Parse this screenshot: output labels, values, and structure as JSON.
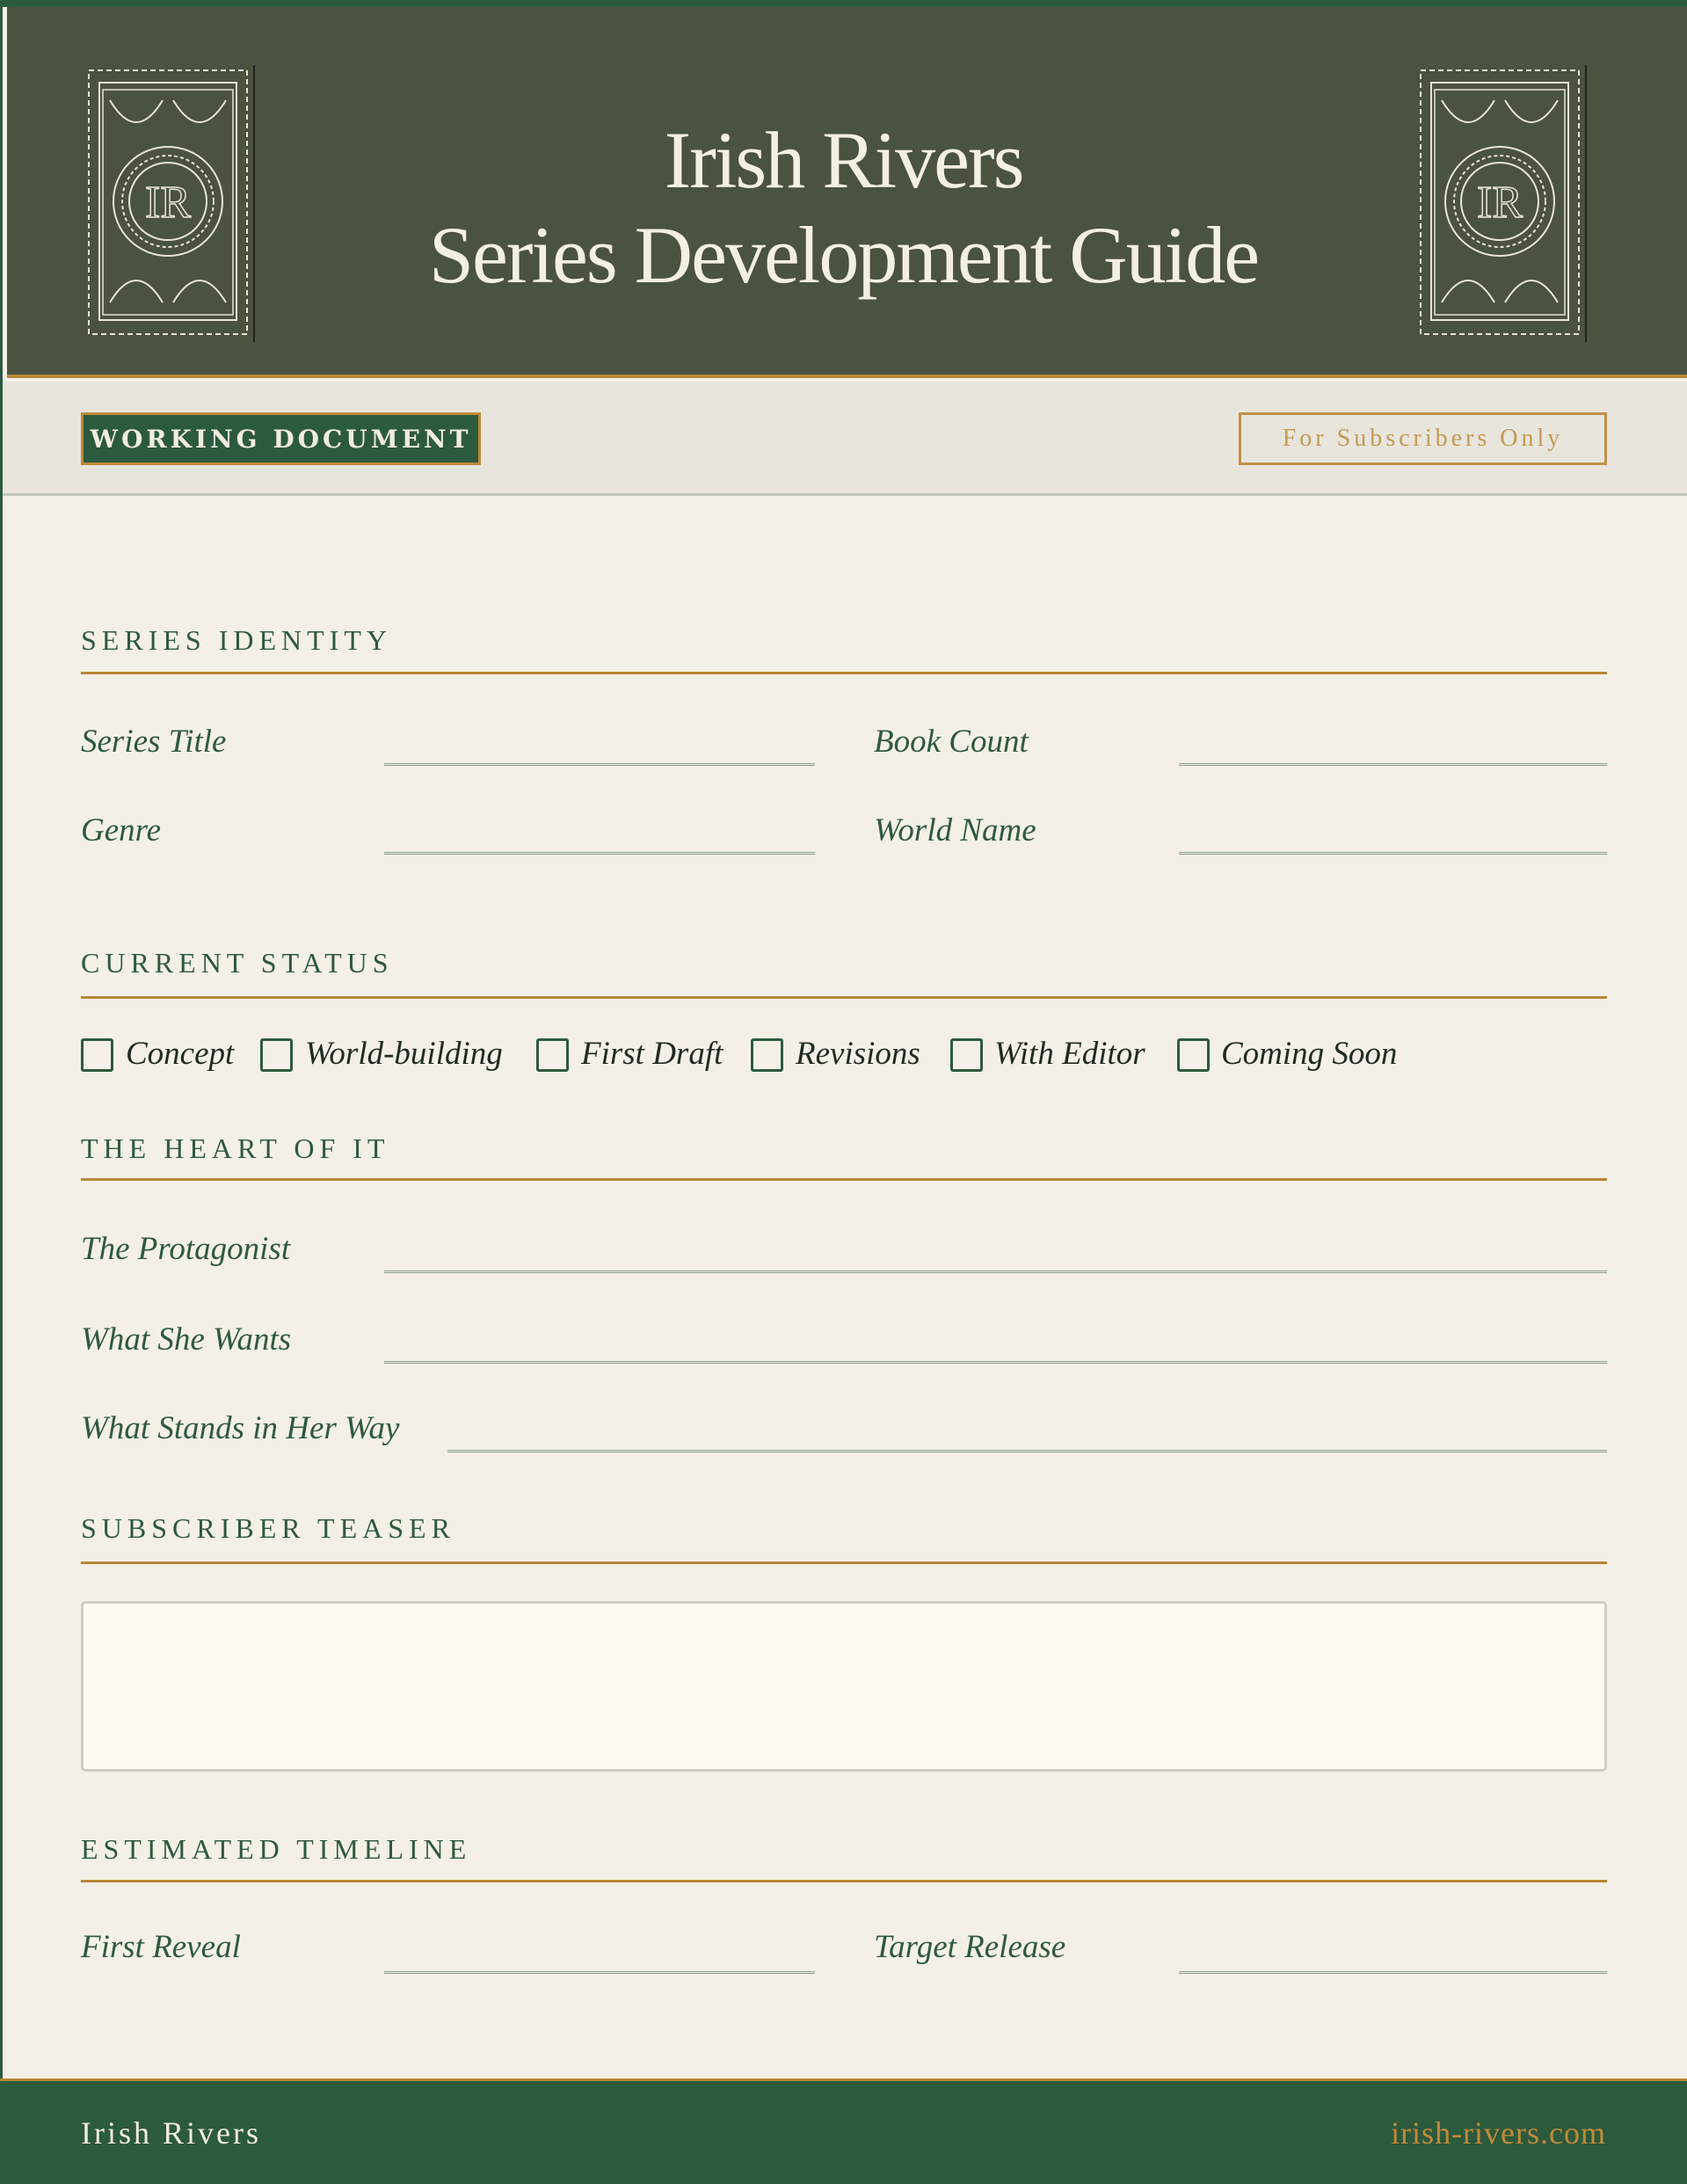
{
  "header": {
    "title_line1": "Irish Rivers",
    "title_line2": "Series Development Guide",
    "logo_text": "IR"
  },
  "badges": {
    "working": "WORKING DOCUMENT",
    "subscribers": "For Subscribers Only"
  },
  "sections": {
    "identity": {
      "heading": "SERIES IDENTITY",
      "fields": [
        "Series Title",
        "Book Count",
        "Genre",
        "World Name"
      ]
    },
    "status": {
      "heading": "CURRENT STATUS",
      "options": [
        "Concept",
        "World-building",
        "First Draft",
        "Revisions",
        "With Editor",
        "Coming Soon"
      ]
    },
    "heart": {
      "heading": "THE HEART OF IT",
      "fields": [
        "The Protagonist",
        "What She Wants",
        "What Stands in Her Way"
      ]
    },
    "teaser": {
      "heading": "SUBSCRIBER TEASER",
      "value": ""
    },
    "timeline": {
      "heading": "ESTIMATED TIMELINE",
      "fields": [
        "First Reveal",
        "Target Release"
      ]
    }
  },
  "footer": {
    "brand": "Irish Rivers",
    "url": "irish-rivers.com"
  },
  "colors": {
    "green": "#2c5a3c",
    "header": "#4a5240",
    "gold": "#b88634",
    "paper": "#f4f0e8"
  }
}
